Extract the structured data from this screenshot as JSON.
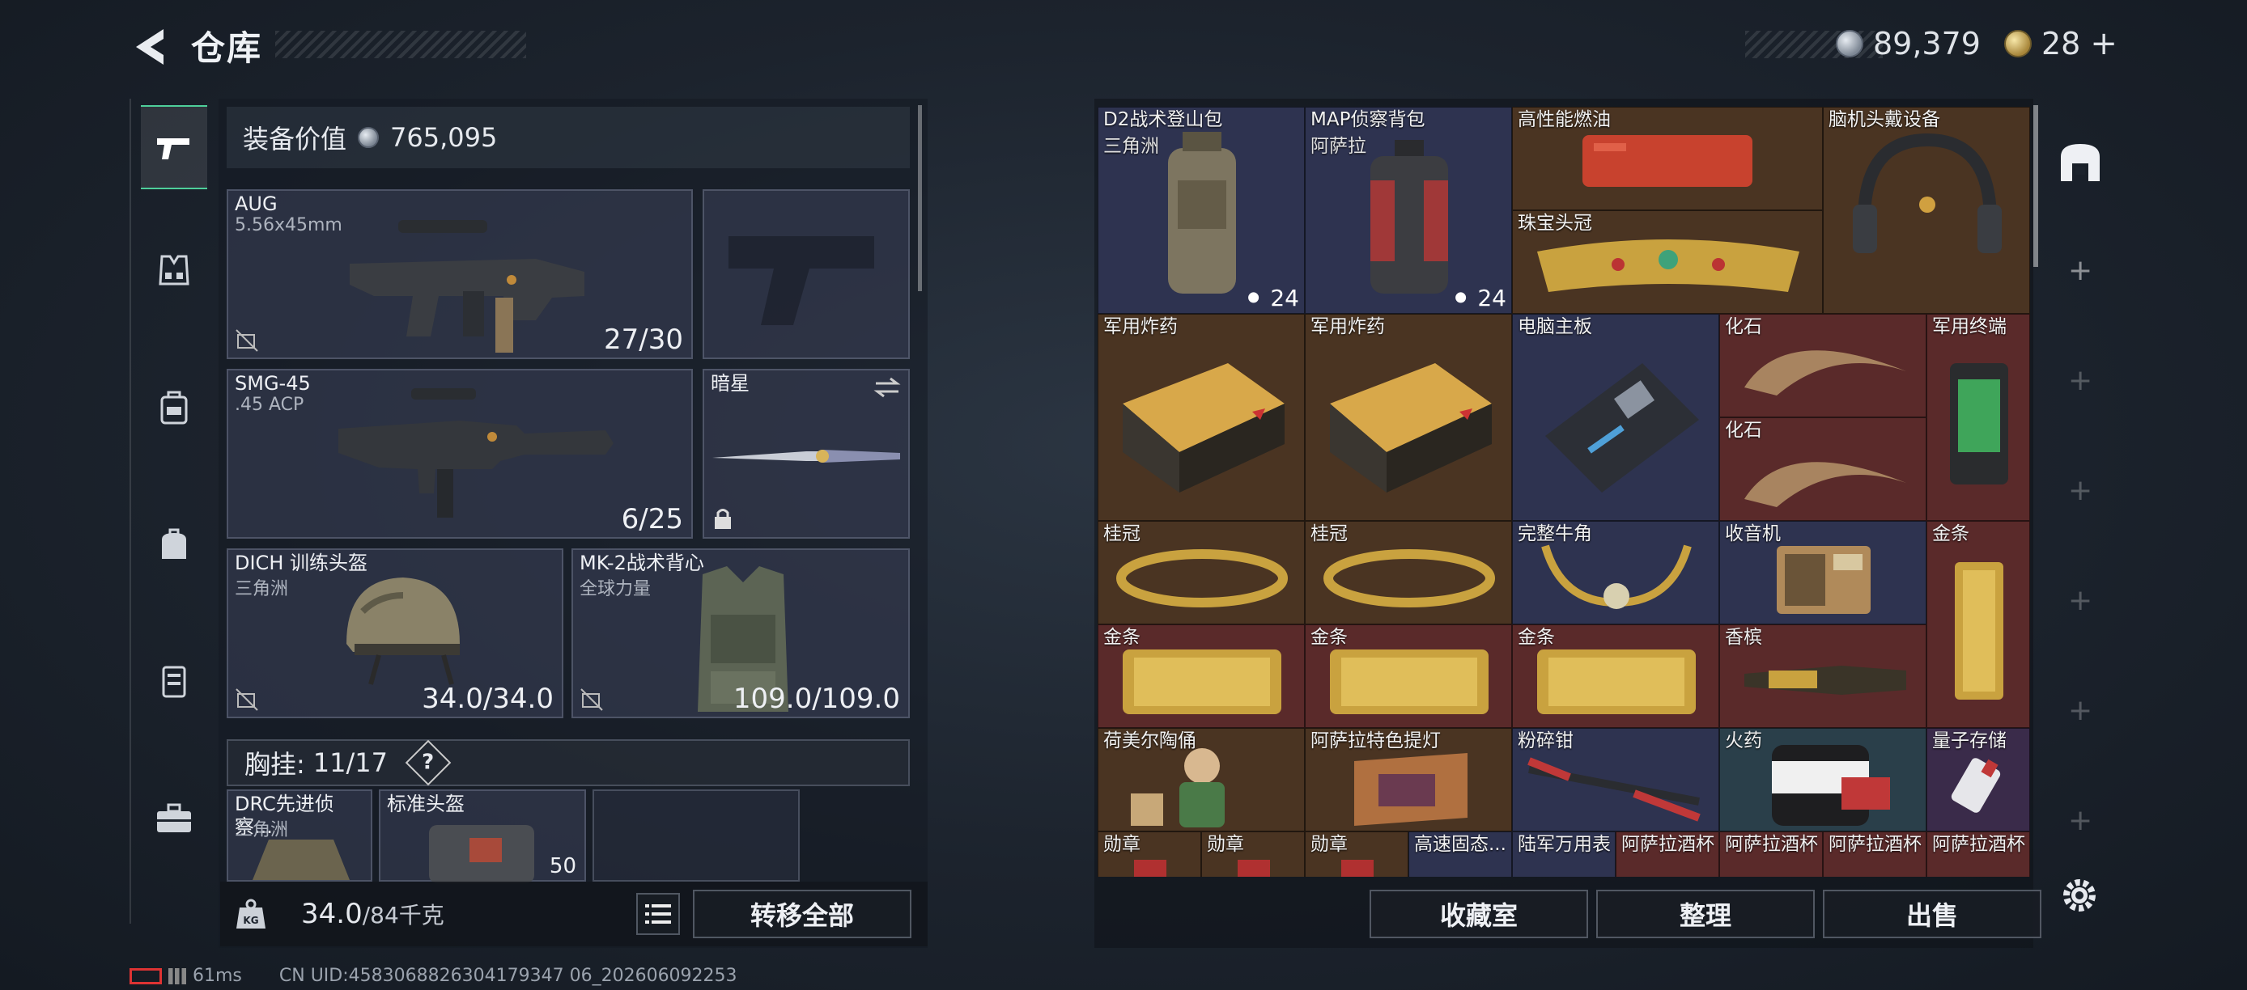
{
  "header": {
    "title": "仓库",
    "coins": "89,379",
    "tickets": "28",
    "add_label": "+"
  },
  "equipment": {
    "value_label": "装备价值",
    "value": "765,095",
    "slots": [
      {
        "name": "AUG",
        "sub": "5.56x45mm",
        "count": "27/30"
      },
      {
        "name": "SMG-45",
        "sub": ".45 ACP",
        "count": "6/25"
      },
      {
        "name": "暗星",
        "sub": "",
        "count": ""
      },
      {
        "name": "DICH 训练头盔",
        "sub": "三角洲",
        "count": "34.0/34.0"
      },
      {
        "name": "MK-2战术背心",
        "sub": "全球力量",
        "count": "109.0/109.0"
      },
      {
        "name": "DRC先进侦察...",
        "sub": "三角洲",
        "count": ""
      },
      {
        "name": "标准头盔",
        "sub": "",
        "count": "50"
      }
    ],
    "chest_rig": {
      "label": "胸挂:",
      "value": "11/17",
      "help": "?"
    }
  },
  "bottom_left": {
    "weight": "34.0",
    "weight_max": "/84千克",
    "transfer_all": "转移全部"
  },
  "bottom_right": {
    "collection": "收藏室",
    "organize": "整理",
    "sell": "出售"
  },
  "status": {
    "ping": "61ms",
    "uid": "CN UID:4583068826304179347 06_202606092253"
  },
  "stash_items": [
    {
      "label": "D2战术登山包",
      "sub": "三角洲",
      "stack": "24"
    },
    {
      "label": "MAP侦察背包",
      "sub": "阿萨拉",
      "stack": "24"
    },
    {
      "label": "高性能燃油"
    },
    {
      "label": "珠宝头冠"
    },
    {
      "label": "脑机头戴设备"
    },
    {
      "label": "军用炸药"
    },
    {
      "label": "军用炸药"
    },
    {
      "label": "电脑主板"
    },
    {
      "label": "化石"
    },
    {
      "label": "化石"
    },
    {
      "label": "军用终端"
    },
    {
      "label": "桂冠"
    },
    {
      "label": "桂冠"
    },
    {
      "label": "完整牛角"
    },
    {
      "label": "收音机"
    },
    {
      "label": "金条"
    },
    {
      "label": "金条"
    },
    {
      "label": "金条"
    },
    {
      "label": "金条"
    },
    {
      "label": "香槟"
    },
    {
      "label": "荷美尔陶俑"
    },
    {
      "label": "阿萨拉特色提灯"
    },
    {
      "label": "粉碎钳"
    },
    {
      "label": "火药"
    },
    {
      "label": "量子存储"
    },
    {
      "label": "勋章"
    },
    {
      "label": "勋章"
    },
    {
      "label": "勋章"
    },
    {
      "label": "高速固态..."
    },
    {
      "label": "陆军万用表"
    },
    {
      "label": "阿萨拉酒杯"
    },
    {
      "label": "阿萨拉酒杯"
    },
    {
      "label": "阿萨拉酒杯"
    },
    {
      "label": "阿萨拉酒杯"
    }
  ]
}
